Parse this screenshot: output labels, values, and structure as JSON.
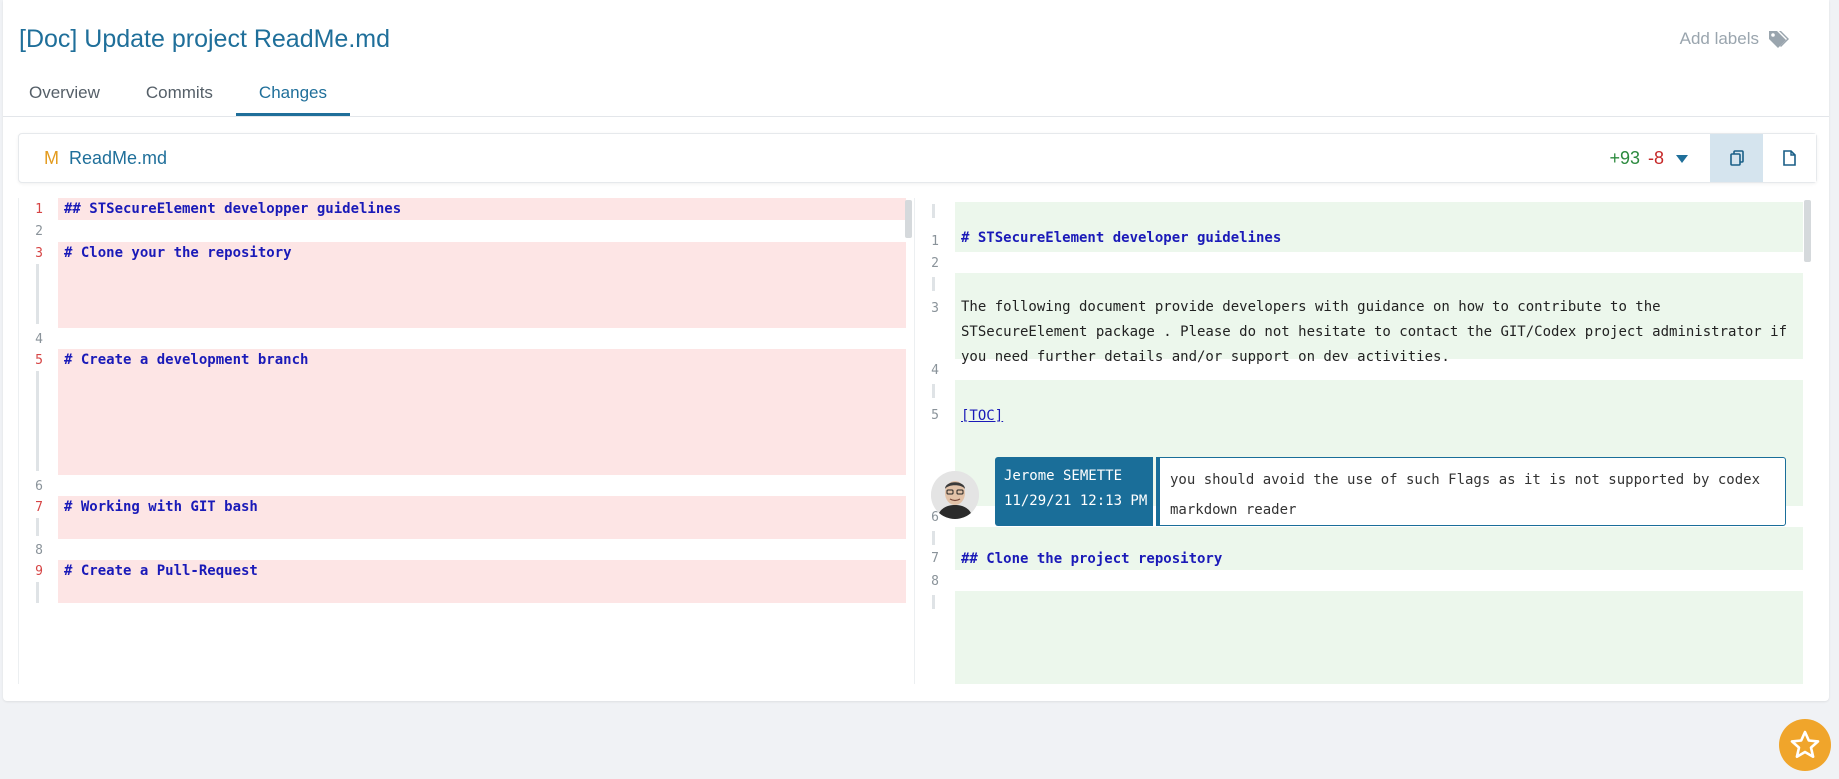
{
  "header": {
    "title": "[Doc] Update project ReadMe.md",
    "add_labels": "Add labels"
  },
  "tabs": [
    {
      "label": "Overview",
      "active": false
    },
    {
      "label": "Commits",
      "active": false
    },
    {
      "label": "Changes",
      "active": true
    }
  ],
  "file": {
    "status": "M",
    "name": "ReadMe.md",
    "additions": "+93",
    "deletions": "-8",
    "view_modes": [
      "side-by-side",
      "unified"
    ],
    "active_view": "side-by-side"
  },
  "left_lines": [
    {
      "num": "1",
      "text": "## STSecureElement developper guidelines",
      "type": "deleted"
    },
    {
      "num": "2",
      "text": "",
      "type": "context"
    },
    {
      "num": "3",
      "text": "# Clone your the repository",
      "type": "deleted"
    },
    {
      "num": "4",
      "text": "",
      "type": "context"
    },
    {
      "num": "5",
      "text": "# Create a development branch",
      "type": "deleted"
    },
    {
      "num": "6",
      "text": "",
      "type": "context"
    },
    {
      "num": "7",
      "text": "# Working with GIT bash",
      "type": "deleted"
    },
    {
      "num": "8",
      "text": "",
      "type": "context"
    },
    {
      "num": "9",
      "text": "# Create a Pull-Request",
      "type": "deleted"
    }
  ],
  "right_lines": [
    {
      "num": "1",
      "text": "# STSecureElement developer guidelines",
      "type": "added"
    },
    {
      "num": "2",
      "text": "",
      "type": "context"
    },
    {
      "num": "3",
      "text": "The following document provide developers with guidance on how to contribute to the STSecureElement package . Please do not hesitate to contact the GIT/Codex project administrator if you need further details and/or support on dev activities.",
      "type": "added"
    },
    {
      "num": "4",
      "text": "",
      "type": "context"
    },
    {
      "num": "5",
      "text": "[TOC]",
      "type": "added"
    },
    {
      "num": "6",
      "text": "",
      "type": "context"
    },
    {
      "num": "7",
      "text": "## Clone the project repository",
      "type": "added"
    },
    {
      "num": "8",
      "text": "",
      "type": "context"
    }
  ],
  "comment": {
    "author": "Jerome SEMETTE",
    "timestamp": "11/29/21 12:13 PM",
    "text": "you should avoid the use of such Flags as it is not supported by codex markdown reader"
  },
  "colors": {
    "accent": "#1f6f9a",
    "deleted_bg": "#fde5e5",
    "added_bg": "#ecf7ec",
    "fab": "#f0a52b"
  },
  "icons": {
    "label": "tags-icon",
    "side_by_side": "copy-icon",
    "unified": "file-icon",
    "fab": "star-icon"
  }
}
